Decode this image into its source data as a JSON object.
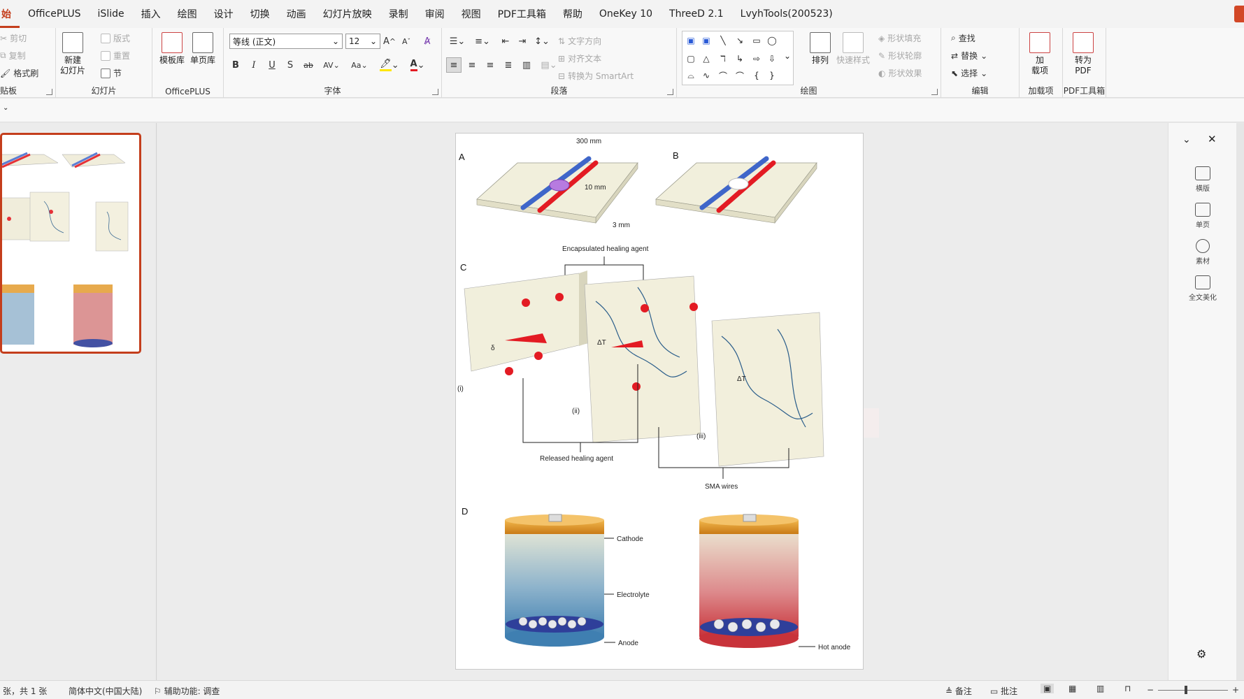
{
  "tabs": [
    "始",
    "OfficePLUS",
    "iSlide",
    "插入",
    "绘图",
    "设计",
    "切换",
    "动画",
    "幻灯片放映",
    "录制",
    "审阅",
    "视图",
    "PDF工具箱",
    "帮助",
    "OneKey 10",
    "ThreeD 2.1",
    "LvyhTools(200523)"
  ],
  "ribbon": {
    "clipboard": {
      "cut": "剪切",
      "copy": "复制",
      "format_painter": "格式刷",
      "label": "贴板"
    },
    "slides": {
      "new_slide": "新建",
      "new_slide2": "幻灯片",
      "layout": "版式",
      "reset": "重置",
      "section": "节",
      "label": "幻灯片"
    },
    "officeplus": {
      "template": "模板库",
      "single": "单页库",
      "label": "OfficePLUS"
    },
    "font": {
      "font_name": "等线 (正文)",
      "font_size": "12",
      "label": "字体",
      "bold": "B",
      "italic": "I",
      "underline": "U",
      "strike": "S",
      "abc": "ab",
      "av": "AV",
      "aa": "Aa",
      "grow": "A",
      "shrink": "A"
    },
    "paragraph": {
      "text_direction": "文字方向",
      "align_text": "对齐文本",
      "smartart": "转换为 SmartArt",
      "label": "段落"
    },
    "drawing": {
      "arrange": "排列",
      "quick_styles": "快速样式",
      "shape_fill": "形状填充",
      "shape_outline": "形状轮廓",
      "shape_effects": "形状效果",
      "label": "绘图"
    },
    "editing": {
      "find": "查找",
      "replace": "替换",
      "select": "选择",
      "label": "编辑"
    },
    "addins": {
      "addins": "加",
      "addins2": "载项",
      "label": "加载项"
    },
    "pdf": {
      "convert": "转为",
      "convert2": "PDF",
      "label": "PDF工具箱"
    }
  },
  "figure": {
    "panel_a": "A",
    "panel_b": "B",
    "panel_c": "C",
    "panel_d": "D",
    "dim_300": "300 mm",
    "dim_10": "10 mm",
    "dim_3": "3 mm",
    "encapsulated": "Encapsulated healing agent",
    "released": "Released healing agent",
    "sma": "SMA wires",
    "stage_i": "(i)",
    "stage_ii": "(ii)",
    "stage_iii": "(iii)",
    "cathode": "Cathode",
    "electrolyte": "Electrolyte",
    "anode": "Anode",
    "hot_anode": "Hot anode",
    "delta_t": "ΔT",
    "delta": "δ"
  },
  "sidepane": {
    "items": [
      "横版",
      "单页",
      "素材",
      "全文美化"
    ]
  },
  "statusbar": {
    "slide_count": "张，共 1 张",
    "language": "简体中文(中国大陆)",
    "accessibility": "辅助功能: 调查",
    "notes": "备注",
    "comments": "批注",
    "zoom_minus": "−",
    "zoom_plus": "+"
  },
  "colors": {
    "accent": "#c43e1c",
    "capsule_red": "#e31b23",
    "wire_blue": "#2a5d8a"
  }
}
